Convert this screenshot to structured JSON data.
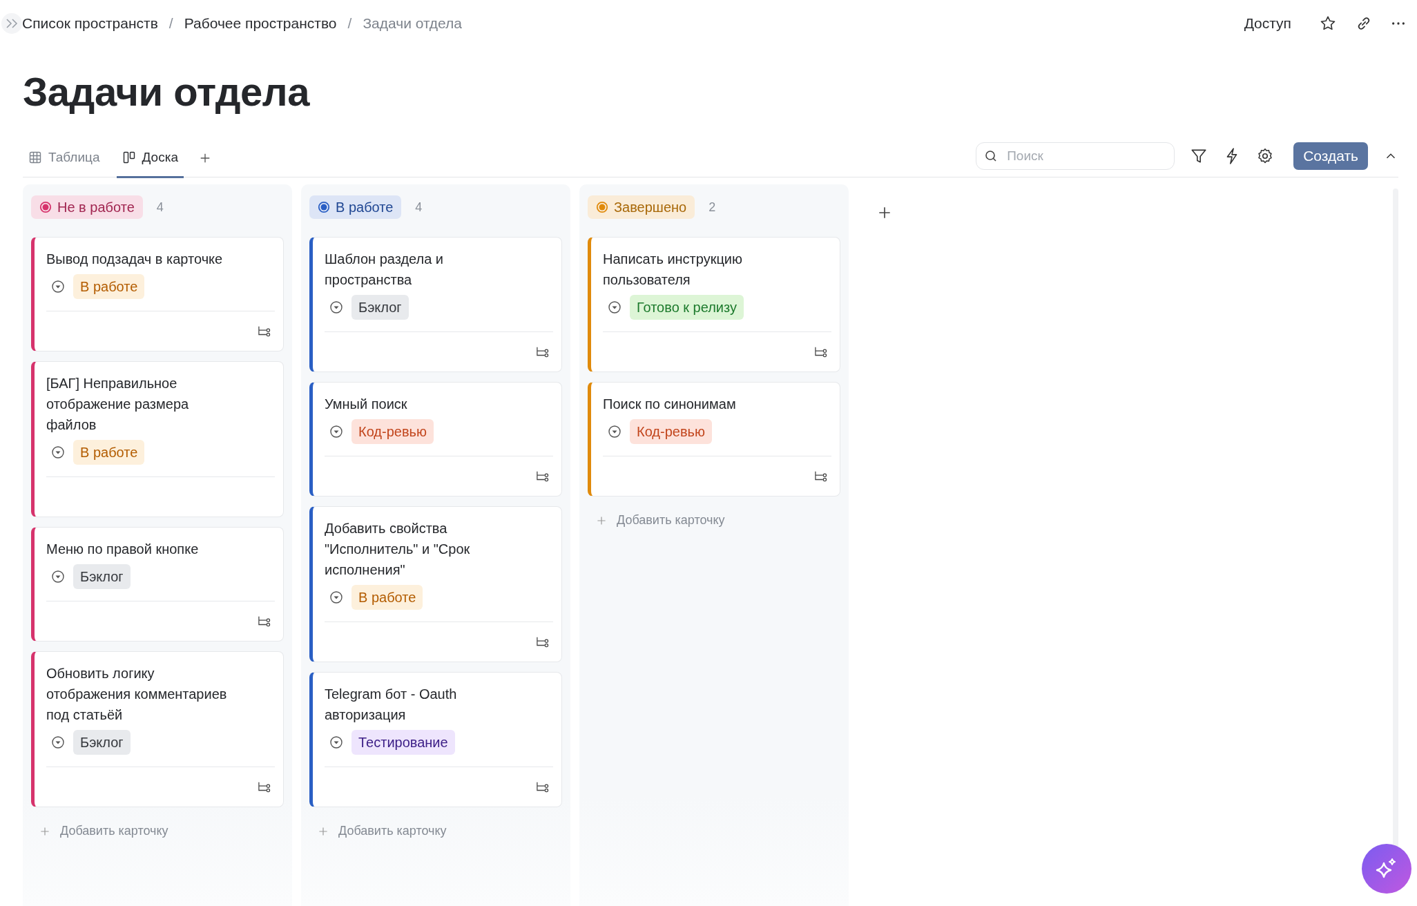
{
  "breadcrumbs": {
    "separator": "/",
    "items": [
      {
        "label": "Список пространств",
        "current": false
      },
      {
        "label": "Рабочее пространство",
        "current": false
      },
      {
        "label": "Задачи отдела",
        "current": true
      }
    ]
  },
  "header_actions": {
    "access": "Доступ"
  },
  "title": "Задачи отдела",
  "tabs": [
    {
      "label": "Таблица",
      "kind": "table",
      "selected": false
    },
    {
      "label": "Доска",
      "kind": "board",
      "selected": true
    }
  ],
  "toolbar": {
    "search": {
      "placeholder": "Поиск"
    },
    "create_button": "Создать"
  },
  "columns": [
    {
      "title": "Не в работе",
      "count": "4",
      "color": "#d6336c",
      "add_card": "Добавить карточку",
      "cards": [
        {
          "title": "Вывод подзадач в карточке",
          "status": {
            "label": "В работе",
            "kind": "in_progress"
          },
          "subtasks": true
        },
        {
          "title": "[БАГ] Неправильное отображение размера файлов",
          "status": {
            "label": "В работе",
            "kind": "in_progress"
          },
          "subtasks": false
        },
        {
          "title": "Меню по правой кнопке",
          "status": {
            "label": "Бэклог",
            "kind": "backlog"
          },
          "subtasks": true
        },
        {
          "title": "Обновить логику отображения комментариев под статьёй",
          "status": {
            "label": "Бэклог",
            "kind": "backlog"
          },
          "subtasks": true
        }
      ]
    },
    {
      "title": "В работе",
      "count": "4",
      "color": "#2a5fc4",
      "add_card": "Добавить карточку",
      "cards": [
        {
          "title": "Шаблон раздела и пространства",
          "status": {
            "label": "Бэклог",
            "kind": "backlog"
          },
          "subtasks": true
        },
        {
          "title": "Умный поиск",
          "status": {
            "label": "Код-ревью",
            "kind": "review"
          },
          "subtasks": true
        },
        {
          "title": "Добавить свойства \"Исполнитель\" и \"Срок исполнения\"",
          "status": {
            "label": "В работе",
            "kind": "in_progress"
          },
          "subtasks": true
        },
        {
          "title": "Telegram бот - Oauth авторизация",
          "status": {
            "label": "Тестирование",
            "kind": "testing"
          },
          "subtasks": true
        }
      ]
    },
    {
      "title": "Завершено",
      "count": "2",
      "color": "#e08a0b",
      "add_card": "Добавить карточку",
      "cards": [
        {
          "title": "Написать инструкцию пользователя",
          "status": {
            "label": "Готово к релизу",
            "kind": "ready"
          },
          "subtasks": true
        },
        {
          "title": "Поиск по синонимам",
          "status": {
            "label": "Код-ревью",
            "kind": "review"
          },
          "subtasks": true
        }
      ]
    }
  ]
}
